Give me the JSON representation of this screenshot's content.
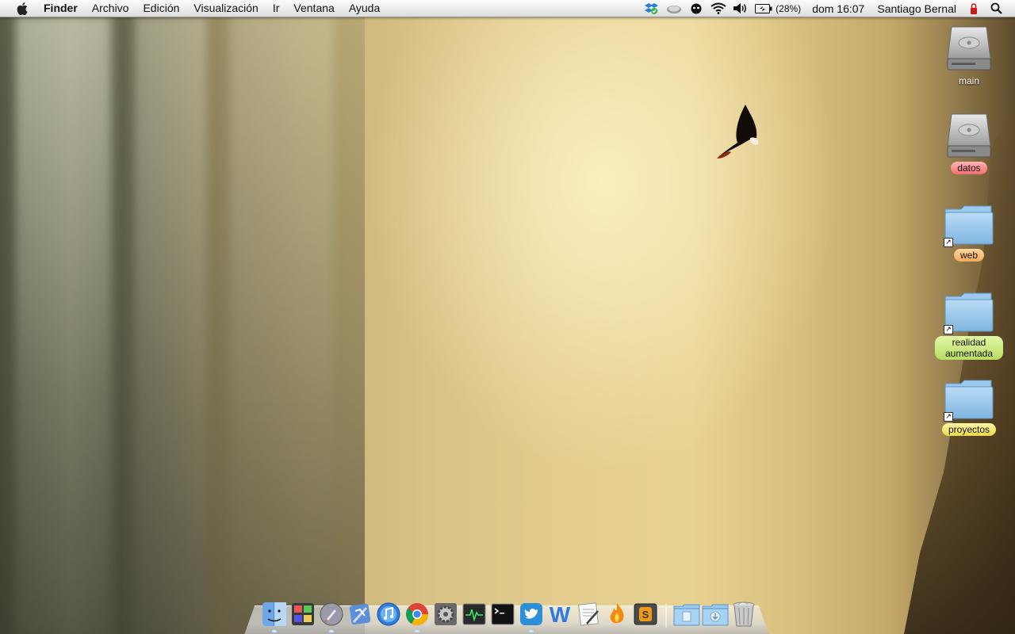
{
  "menubar": {
    "apple_icon": "apple-logo-icon",
    "app_name": "Finder",
    "menus": [
      "Archivo",
      "Edición",
      "Visualización",
      "Ir",
      "Ventana",
      "Ayuda"
    ],
    "status_icons": [
      "dropbox-icon",
      "cloud-sync-icon",
      "alien-icon",
      "wifi-icon",
      "volume-icon"
    ],
    "battery_pct": "(28%)",
    "clock": "dom 16:07",
    "user": "Santiago Bernal",
    "extra_icons": [
      "lock-status-icon",
      "spotlight-search-icon"
    ]
  },
  "desktop": {
    "icons": [
      {
        "label": "main",
        "kind": "hard-drive",
        "tag": ""
      },
      {
        "label": "datos",
        "kind": "hard-drive",
        "tag": "red"
      },
      {
        "label": "web",
        "kind": "folder-alias",
        "tag": "orange"
      },
      {
        "label": "realidad aumentada",
        "kind": "folder-alias",
        "tag": "green"
      },
      {
        "label": "proyectos",
        "kind": "folder-alias",
        "tag": "yellow"
      }
    ]
  },
  "dock": {
    "apps": [
      "finder-icon",
      "photo-booth-icon",
      "launchpad-icon",
      "xcode-icon",
      "itunes-icon",
      "chrome-icon",
      "system-preferences-icon",
      "activity-monitor-icon",
      "terminal-icon",
      "twitter-icon",
      "word-icon",
      "textedit-icon",
      "flame-app-icon",
      "sublime-text-icon"
    ],
    "stacks": [
      "documents-stack-icon",
      "downloads-stack-icon",
      "trash-icon"
    ],
    "colors": {
      "folder": "#8ec3ea",
      "tag_red": "#f27070"
    }
  }
}
